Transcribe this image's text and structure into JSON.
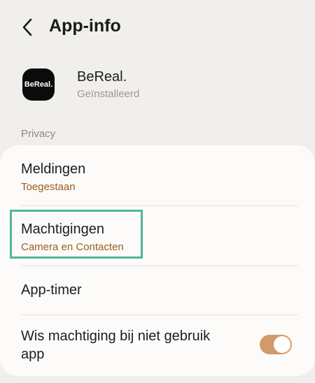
{
  "header": {
    "title": "App-info"
  },
  "app": {
    "icon_text": "BeReal.",
    "name": "BeReal.",
    "status": "Geïnstalleerd"
  },
  "section": {
    "label": "Privacy"
  },
  "items": [
    {
      "title": "Meldingen",
      "subtitle": "Toegestaan"
    },
    {
      "title": "Machtigingen",
      "subtitle": "Camera en Contacten"
    },
    {
      "title": "App-timer"
    },
    {
      "title_line1": "Wis machtiging bij niet gebruik",
      "title_line2": "app",
      "toggle_on": true
    }
  ],
  "colors": {
    "accent": "#9a5d1e",
    "highlight": "#4fb896",
    "toggle": "#d3996a"
  }
}
